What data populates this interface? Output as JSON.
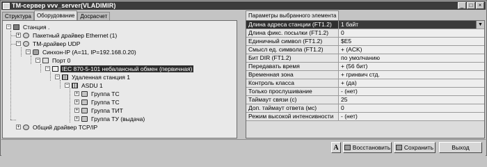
{
  "window": {
    "title": "TM-сервер vvv_server(VLADIMIR)"
  },
  "left_tabs": [
    "Структура",
    "Оборудование",
    "Досрасчет"
  ],
  "tree": [
    {
      "label": "Станция ."
    },
    {
      "label": "Пакетный драйвер Ethernet (1)"
    },
    {
      "label": "TM-драйвер UDP"
    },
    {
      "label": "Синхон-IP (A=11, IP=192.168.0.20)"
    },
    {
      "label": "Порт 0"
    },
    {
      "label": "IEC 870-5-101 небалансный обмен (первичная)"
    },
    {
      "label": "Удаленная станция 1"
    },
    {
      "label": "ASDU 1"
    },
    {
      "label": "Группа ТС"
    },
    {
      "label": "Группа ТС"
    },
    {
      "label": "Группа ТИТ"
    },
    {
      "label": "Группа ТУ (выдача)"
    },
    {
      "label": "Общий драйвер TCP/IP"
    }
  ],
  "right_tab": "Параметры выбранного элемента",
  "properties": [
    {
      "name": "Длина адреса станции (FT1.2)",
      "value": "1 байт"
    },
    {
      "name": "Длина фикс. посылки (FT1.2)",
      "value": "0"
    },
    {
      "name": "Единичный символ (FT1.2)",
      "value": "$E5"
    },
    {
      "name": "Смысл ед. символа (FT1.2)",
      "value": "+ (ACK)"
    },
    {
      "name": "Бит DIR (FT1.2)",
      "value": "по умолчанию"
    },
    {
      "name": "Передавать время",
      "value": "+ (56 бит)"
    },
    {
      "name": "Временная зона",
      "value": "+ гринвич стд."
    },
    {
      "name": "Контроль класса",
      "value": "+ (да)"
    },
    {
      "name": "Только прослушивание",
      "value": "- (нет)"
    },
    {
      "name": "Таймаут связи (с)",
      "value": "25"
    },
    {
      "name": "Доп. таймаут ответа (мс)",
      "value": "0"
    },
    {
      "name": "Режим высокой интенсивности",
      "value": "- (нет)"
    }
  ],
  "buttons": {
    "font": "A",
    "restore": "Восстановить",
    "save": "Сохранить",
    "exit": "Выход"
  }
}
